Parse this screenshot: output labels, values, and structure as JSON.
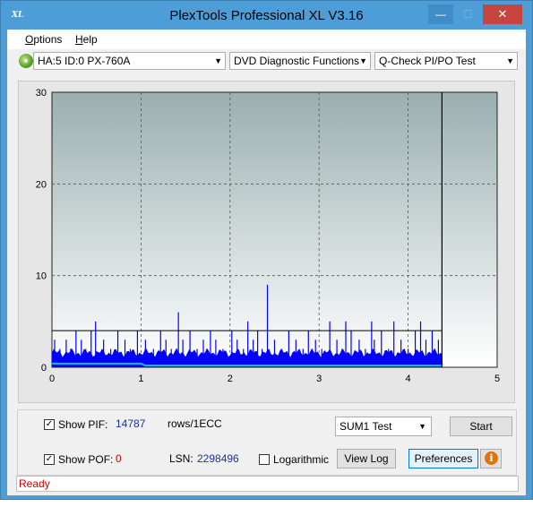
{
  "window": {
    "title": "PlexTools Professional XL V3.16",
    "app_icon_text": "XL",
    "min_glyph": "—",
    "max_glyph": "☐",
    "close_glyph": "✕"
  },
  "menu": {
    "options_prefix": "O",
    "options_rest": "ptions",
    "help_prefix": "H",
    "help_rest": "elp"
  },
  "toolbar": {
    "drive": "HA:5 ID:0  PX-760A",
    "function": "DVD Diagnostic Functions",
    "test": "Q-Check PI/PO Test",
    "drive_icon": "disc-icon"
  },
  "chart_data": {
    "type": "bar",
    "x_ticks": [
      "0",
      "1",
      "2",
      "3",
      "4",
      "5"
    ],
    "y_ticks": [
      "0",
      "10",
      "20",
      "30"
    ],
    "xlim": [
      0,
      5
    ],
    "ylim": [
      0,
      30
    ],
    "threshold": 4,
    "end_marker_x": 4.38,
    "grid": true,
    "series": [
      {
        "color": "#0000ff",
        "x": [
          0.03,
          0.09,
          0.16,
          0.21,
          0.27,
          0.33,
          0.38,
          0.44,
          0.49,
          0.58,
          0.66,
          0.74,
          0.82,
          0.88,
          0.96,
          1.05,
          1.14,
          1.22,
          1.28,
          1.34,
          1.42,
          1.47,
          1.55,
          1.63,
          1.7,
          1.78,
          1.84,
          1.92,
          2.02,
          2.08,
          2.15,
          2.2,
          2.26,
          2.31,
          2.36,
          2.42,
          2.5,
          2.58,
          2.66,
          2.74,
          2.82,
          2.88,
          2.96,
          3.03,
          3.12,
          3.2,
          3.26,
          3.3,
          3.36,
          3.45,
          3.52,
          3.59,
          3.62,
          3.7,
          3.78,
          3.84,
          3.92,
          4.0,
          4.08,
          4.14,
          4.2,
          4.27,
          4.34
        ],
        "values": [
          3,
          2,
          3,
          2,
          4,
          3,
          2,
          4,
          5,
          3,
          2,
          4,
          3,
          2,
          4,
          3,
          2,
          4,
          3,
          2,
          6,
          3,
          4,
          2,
          3,
          4,
          3,
          2,
          4,
          3,
          2,
          5,
          3,
          4,
          2,
          9,
          3,
          2,
          4,
          3,
          2,
          4,
          3,
          2,
          5,
          3,
          2,
          5,
          4,
          3,
          2,
          5,
          3,
          4,
          2,
          5,
          3,
          2,
          4,
          5,
          3,
          4,
          3
        ]
      },
      {
        "color": "#00c8e6",
        "x": [
          0.0,
          1.0,
          1.05,
          4.38
        ],
        "values": [
          0.4,
          0.4,
          0.2,
          0.2
        ]
      }
    ]
  },
  "controls": {
    "show_pif_label": "Show PIF:",
    "pif_value": "14787",
    "rows_label": "rows/1ECC",
    "show_pof_label": "Show POF:",
    "pof_value": "0",
    "lsn_label": "LSN:",
    "lsn_value": "2298496",
    "logarithmic_label": "Logarithmic",
    "sum_select": "SUM1 Test",
    "start_label": "Start",
    "viewlog_label": "View Log",
    "preferences_label": "Preferences",
    "check_mark": "✓"
  },
  "status": {
    "text": "Ready"
  }
}
